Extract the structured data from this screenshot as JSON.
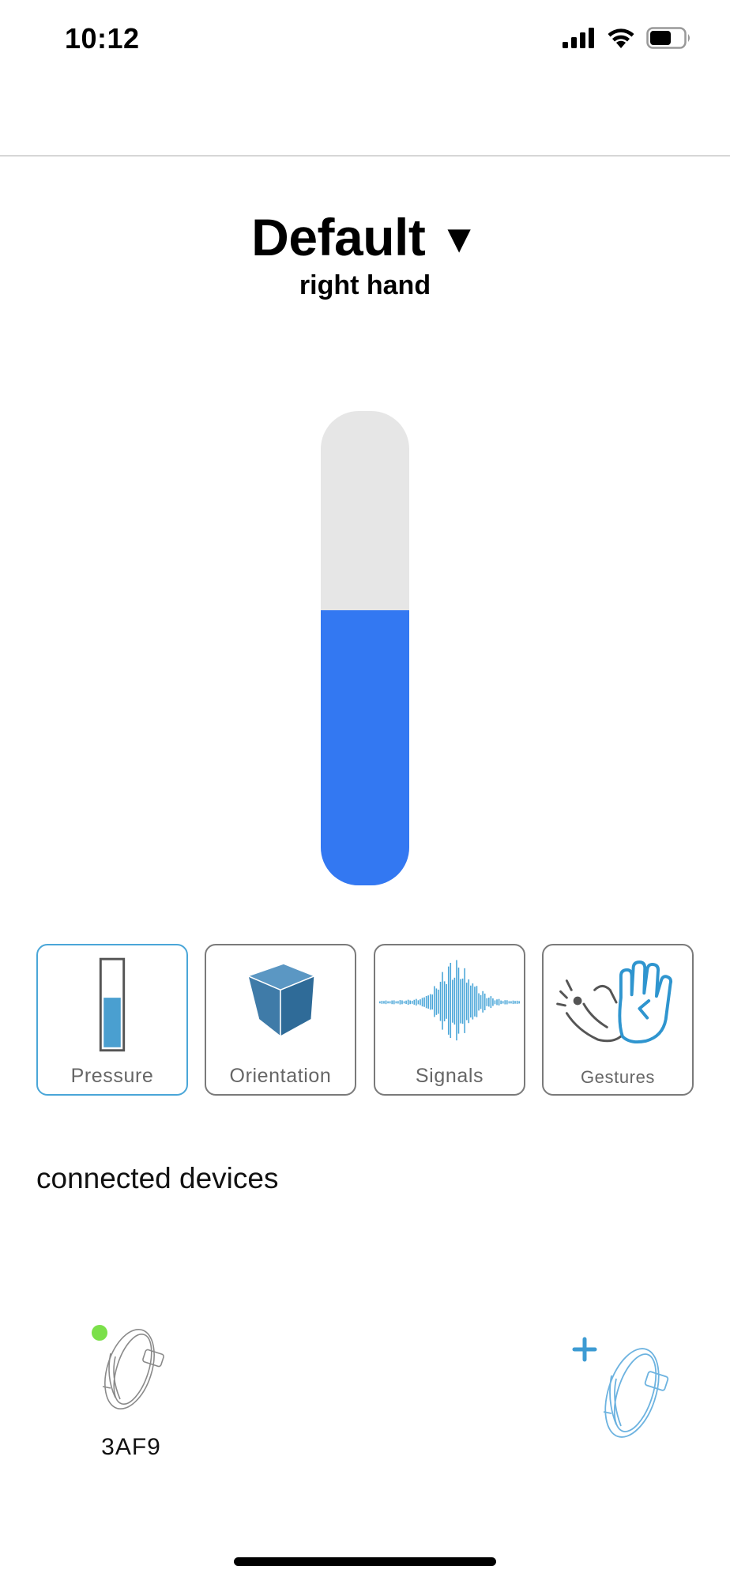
{
  "status_bar": {
    "time": "10:12",
    "icons": [
      "cellular-signal-icon",
      "wifi-icon",
      "battery-icon"
    ]
  },
  "header": {
    "title": "Default",
    "dropdown_caret": "▼",
    "subtitle": "right hand"
  },
  "pressure": {
    "level": 0.58,
    "fill_color": "#3378f2",
    "track_color": "#e6e6e6"
  },
  "modes": [
    {
      "label": "Pressure",
      "icon": "pressure-gauge-icon",
      "selected": true
    },
    {
      "label": "Orientation",
      "icon": "cube-icon",
      "selected": false
    },
    {
      "label": "Signals",
      "icon": "waveform-icon",
      "selected": false
    },
    {
      "label": "Gestures",
      "icon": "hand-gesture-icon",
      "selected": false
    }
  ],
  "devices": {
    "section_title": "connected devices",
    "items": [
      {
        "name": "3AF9",
        "icon": "wristband-icon",
        "status_color": "#7be04a"
      }
    ],
    "add_button_icon": "add-wristband-icon"
  },
  "colors": {
    "accent": "#4aa6d8",
    "tile_border": "#7a7a7a"
  }
}
